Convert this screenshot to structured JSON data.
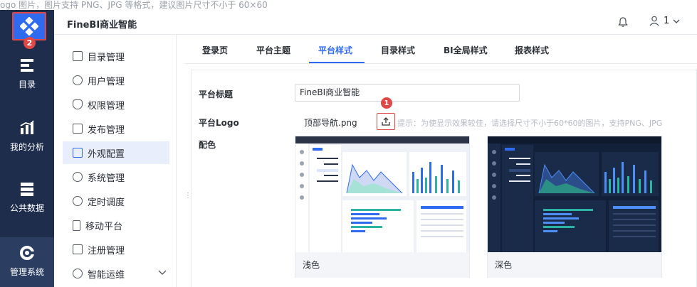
{
  "background_strip": "ogo 图片，图片支持 PNG、JPG 等格式，建议图片尺寸不小于 60×60",
  "rail": {
    "badge": "2",
    "items": [
      {
        "label": "目录",
        "icon": "catalog-icon"
      },
      {
        "label": "我的分析",
        "icon": "analysis-icon"
      },
      {
        "label": "公共数据",
        "icon": "public-data-icon"
      },
      {
        "label": "管理系统",
        "icon": "manage-system-icon"
      }
    ]
  },
  "header": {
    "title": "FineBI商业智能",
    "user": "1"
  },
  "subnav": {
    "items": [
      {
        "label": "目录管理"
      },
      {
        "label": "用户管理"
      },
      {
        "label": "权限管理"
      },
      {
        "label": "发布管理"
      },
      {
        "label": "外观配置"
      },
      {
        "label": "系统管理"
      },
      {
        "label": "定时调度"
      },
      {
        "label": "移动平台"
      },
      {
        "label": "注册管理"
      },
      {
        "label": "智能运维"
      }
    ]
  },
  "tabs": [
    {
      "label": "登录页"
    },
    {
      "label": "平台主题"
    },
    {
      "label": "平台样式"
    },
    {
      "label": "目录样式"
    },
    {
      "label": "BI全局样式"
    },
    {
      "label": "报表样式"
    }
  ],
  "form": {
    "platform_title_label": "平台标题",
    "platform_title_value": "FineBI商业智能",
    "platform_logo_label": "平台Logo",
    "logo_file": "顶部导航.png",
    "upload_badge": "1",
    "hint": "提示：为使显示效果较佳，请选择尺寸不小于60*60的图片，支持PNG、JPG",
    "color_label": "配色",
    "themes": [
      {
        "label": "浅色"
      },
      {
        "label": "深色"
      }
    ]
  },
  "colors": {
    "rail_bg": "#1f2d4d",
    "accent": "#2f6bf1",
    "annotation": "#e04848"
  }
}
